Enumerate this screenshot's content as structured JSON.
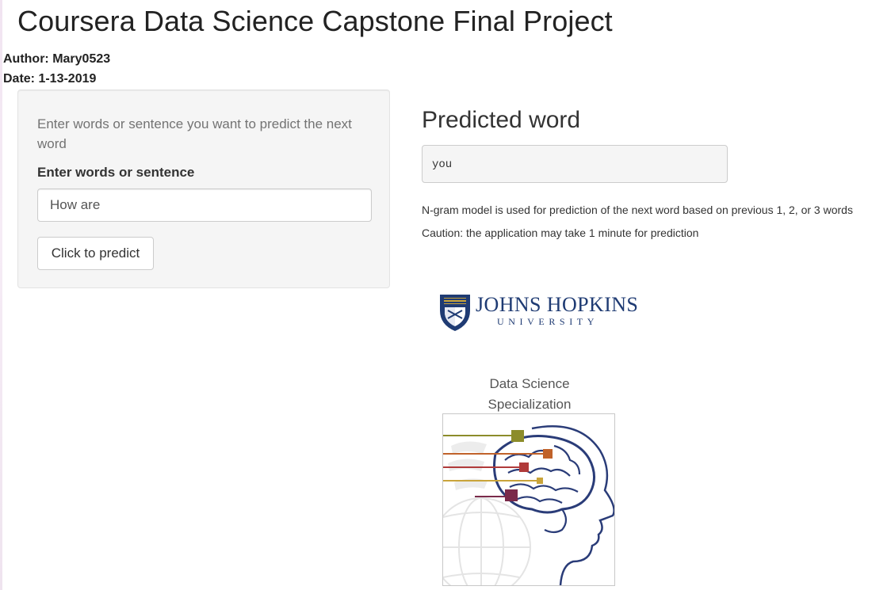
{
  "page": {
    "title": "Coursera Data Science Capstone Final Project",
    "author": "Author: Mary0523",
    "date": "Date: 1-13-2019"
  },
  "sidebar": {
    "help_text": "Enter words or sentence you want to predict the next word",
    "input_label": "Enter words or sentence",
    "input_value": "How are",
    "button_label": "Click to predict"
  },
  "main": {
    "heading": "Predicted word",
    "prediction": "you",
    "info_line_1": "N-gram model is used for prediction of the next word based on previous 1, 2, or 3 words",
    "info_line_2": "Caution: the application may take 1 minute for prediction"
  },
  "logo": {
    "name": "JOHNS HOPKINS",
    "subtitle": "UNIVERSITY"
  },
  "specialization": {
    "line1": "Data Science",
    "line2": "Specialization"
  },
  "colors": {
    "jhu_blue": "#1f3b73",
    "bar_olive": "#8c8c2a",
    "bar_orange": "#c0622a",
    "bar_red": "#b03a3a",
    "bar_maroon": "#7a2a4a",
    "brain_blue": "#2a3c78"
  }
}
